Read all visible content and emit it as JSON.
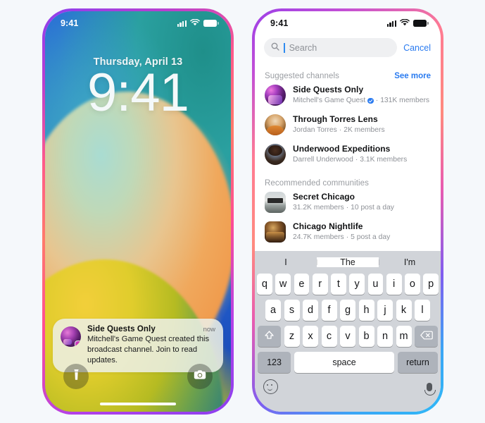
{
  "page": {
    "background_color": "#f5f8fb"
  },
  "left_phone": {
    "frame_gradient": "#8b3ff0 -> #ff5a8a -> #b341e8",
    "status_bar": {
      "time": "9:41",
      "icons": [
        "cellular-bars-icon",
        "wifi-icon",
        "battery-icon"
      ]
    },
    "lock_screen": {
      "date": "Thursday, April 13",
      "time": "9:41"
    },
    "notification": {
      "title": "Side Quests Only",
      "timestamp": "now",
      "body": "Mitchell's Game Quest created this broadcast channel. Join to read updates.",
      "avatar_name": "side-quests-avatar",
      "badge_name": "messenger-badge-icon"
    },
    "actions": [
      {
        "name": "flashlight-button",
        "icon": "flashlight-icon"
      },
      {
        "name": "camera-button",
        "icon": "camera-icon"
      }
    ]
  },
  "right_phone": {
    "frame_gradient": "#9b3fe8 -> #ff7b92 -> #2fb9f7",
    "status_bar": {
      "time": "9:41",
      "icons": [
        "cellular-bars-icon",
        "wifi-icon",
        "battery-icon"
      ]
    },
    "search": {
      "placeholder": "Search",
      "value": "",
      "cancel_label": "Cancel",
      "icon": "search-icon"
    },
    "sections": [
      {
        "title": "Suggested channels",
        "action_label": "See more",
        "items": [
          {
            "name": "Side Quests Only",
            "subtitle_owner": "Mitchell's Game Quest",
            "verified": true,
            "subtitle_meta": "131K members",
            "avatar": "side-quests-avatar",
            "avatar_shape": "circle"
          },
          {
            "name": "Through Torres Lens",
            "subtitle_owner": "Jordan Torres",
            "verified": false,
            "subtitle_meta": "2K members",
            "avatar": "torres-avatar",
            "avatar_shape": "circle"
          },
          {
            "name": "Underwood Expeditions",
            "subtitle_owner": "Darrell Underwood",
            "verified": false,
            "subtitle_meta": "3.1K members",
            "avatar": "underwood-avatar",
            "avatar_shape": "circle"
          }
        ]
      },
      {
        "title": "Recommended communities",
        "action_label": "",
        "items": [
          {
            "name": "Secret Chicago",
            "subtitle_owner": "31.2K members",
            "verified": false,
            "subtitle_meta": "10 post a day",
            "avatar": "secret-chicago-avatar",
            "avatar_shape": "square"
          },
          {
            "name": "Chicago Nightlife",
            "subtitle_owner": "24.7K members",
            "verified": false,
            "subtitle_meta": "5 post a day",
            "avatar": "chicago-nightlife-avatar",
            "avatar_shape": "square"
          }
        ]
      }
    ],
    "keyboard": {
      "suggestions": [
        "I",
        "The",
        "I'm"
      ],
      "row1": [
        "q",
        "w",
        "e",
        "r",
        "t",
        "y",
        "u",
        "i",
        "o",
        "p"
      ],
      "row2": [
        "a",
        "s",
        "d",
        "f",
        "g",
        "h",
        "j",
        "k",
        "l"
      ],
      "row3": [
        "z",
        "x",
        "c",
        "v",
        "b",
        "n",
        "m"
      ],
      "shift_icon": "shift-icon",
      "backspace_icon": "backspace-icon",
      "numbers_label": "123",
      "space_label": "space",
      "return_label": "return",
      "emoji_icon": "emoji-icon",
      "mic_icon": "microphone-icon"
    }
  },
  "colors": {
    "accent_blue": "#2a7bf0",
    "muted_gray": "#8e9197",
    "keyboard_bg": "#d1d4d9",
    "key_bg": "#ffffff"
  }
}
